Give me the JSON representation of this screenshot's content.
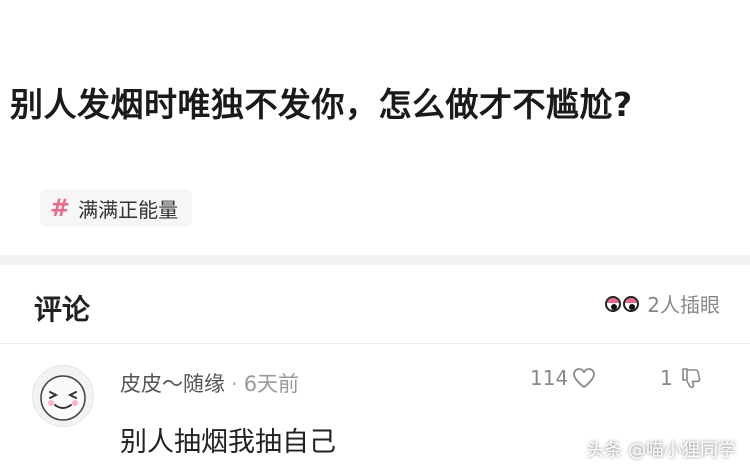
{
  "post": {
    "question": "别人发烟时唯独不发你，怎么做才不尴尬?",
    "tag": {
      "icon": "hashtag-icon",
      "label": "满满正能量"
    }
  },
  "comments": {
    "title": "评论",
    "peek": {
      "icon": "peeking-eyes-icon",
      "label": "2人插眼"
    },
    "items": [
      {
        "avatar": "smiley-face-avatar",
        "username": "皮皮〜随缘",
        "separator": "·",
        "time": "6天前",
        "likes": "114",
        "replies": "1",
        "text": "别人抽烟我抽自己"
      }
    ]
  },
  "watermark": "头条 @喵小狸同学",
  "colors": {
    "accent": "#e86a8a",
    "divider": "#f2f2f2",
    "muted": "#888888"
  }
}
